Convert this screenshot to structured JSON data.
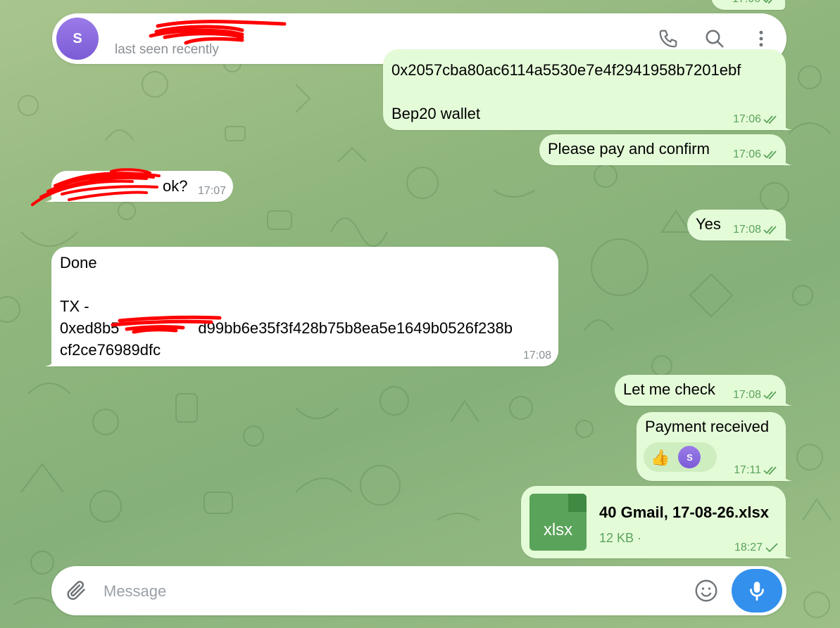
{
  "header": {
    "avatar_letter": "S",
    "chat_name": "",
    "status": "last seen recently",
    "call_icon": "phone-icon",
    "search_icon": "search-icon",
    "menu_icon": "more-vertical-icon"
  },
  "messages": [
    {
      "id": "m-top-partial",
      "direction": "out",
      "text": "",
      "time": "17:06",
      "read": true
    },
    {
      "id": "m-wallet",
      "direction": "out",
      "text": "0x2057cba80ac6114a5530e7e4f2941958b7201ebf\n\nBep20 wallet",
      "time": "17:06",
      "read": true
    },
    {
      "id": "m-pay",
      "direction": "out",
      "text": "Please pay and confirm",
      "time": "17:06",
      "read": true
    },
    {
      "id": "m-ok",
      "direction": "in",
      "text": "ok?",
      "time": "17:07"
    },
    {
      "id": "m-yes",
      "direction": "out",
      "text": "Yes",
      "time": "17:08",
      "read": true
    },
    {
      "id": "m-done",
      "direction": "in",
      "line1": "Done",
      "line2": "TX -",
      "line3": "0xed8b5",
      "line3b": "d99bb6e35f3f428b75b8ea5e1649b0526f238b",
      "line4": "cf2ce76989dfc",
      "time": "17:08"
    },
    {
      "id": "m-check",
      "direction": "out",
      "text": "Let me check",
      "time": "17:08",
      "read": true
    },
    {
      "id": "m-received",
      "direction": "out",
      "text": "Payment received",
      "time": "17:11",
      "read": true,
      "reaction": {
        "emoji": "👍",
        "avatar_letter": "S"
      }
    },
    {
      "id": "m-file",
      "direction": "out",
      "file_ext": "xlsx",
      "file_name": "40 Gmail, 17-08-26.xlsx",
      "file_size": "12 KB ·",
      "time": "18:27",
      "read": false
    }
  ],
  "composer": {
    "placeholder": "Message",
    "value": "",
    "attach_icon": "paperclip-icon",
    "emoji_icon": "smile-icon",
    "send_icon": "microphone-icon"
  },
  "colors": {
    "outgoing_bubble": "#e4fbd8",
    "incoming_bubble": "#ffffff",
    "check_green": "#5aa35a",
    "accent_blue": "#3390ec",
    "avatar_purple": "#8a6be0",
    "redaction_red": "#ff0000"
  }
}
